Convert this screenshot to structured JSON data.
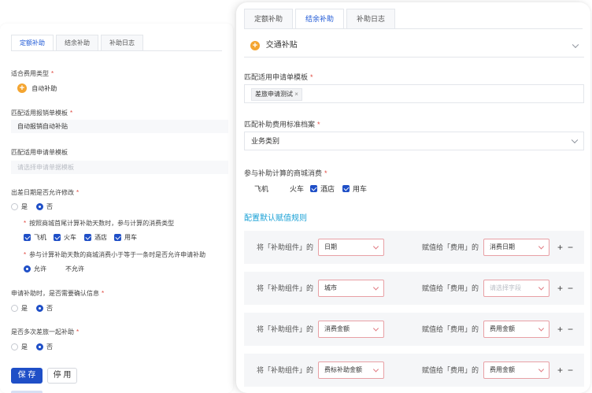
{
  "left": {
    "tabs": [
      "定额补助",
      "结余补助",
      "补助日志"
    ],
    "expense_type": {
      "label": "适合费用类型",
      "value": "自动补助"
    },
    "report_template": {
      "label": "匹配适用报销单模板",
      "value": "自动报销自动补贴"
    },
    "apply_template": {
      "label": "匹配适用申请单模板",
      "placeholder": "请选择申请单据模板"
    },
    "date_modify": {
      "label": "出差日期是否允许修改",
      "options": [
        "是",
        "否"
      ]
    },
    "city_note": "按照商城首尾计算补助天数时，参与计算的消费类型",
    "consume_types": [
      "飞机",
      "火车",
      "酒店",
      "用车"
    ],
    "consume_note": "参与计算补助天数的商城消费小于等于一条时是否允许申请补助",
    "allow_options": [
      "允许",
      "不允许"
    ],
    "confirm_info": {
      "label": "申请补助时，是否需要确认信息",
      "options": [
        "是",
        "否"
      ]
    },
    "multi_trip": {
      "label": "是否多次差旅一起补助",
      "options": [
        "是",
        "否"
      ]
    },
    "save_label": "保 存",
    "stop_label": "停 用"
  },
  "right": {
    "tabs": [
      "定额补助",
      "结余补助",
      "补助日志"
    ],
    "section_title": "交通补贴",
    "apply_template": {
      "label": "匹配适用申请单模板",
      "tag": "差旅申请测试"
    },
    "standard_file": {
      "label": "匹配补助费用标准档案",
      "value": "业务类别"
    },
    "mall_consume": {
      "label": "参与补助计算的商城消费",
      "options": [
        "飞机",
        "火车",
        "酒店",
        "用车"
      ]
    },
    "config_link": "配置默认赋值规则",
    "rule_prefix": "将「补助组件」的",
    "rule_mid": "赋值给「费用」的",
    "rules": [
      {
        "component": "日期",
        "expense": "消费日期",
        "expense_placeholder": false
      },
      {
        "component": "城市",
        "expense": "请选择字段",
        "expense_placeholder": true
      },
      {
        "component": "消费金额",
        "expense": "费用金额",
        "expense_placeholder": false
      },
      {
        "component": "费标补助金额",
        "expense": "费用金额",
        "expense_placeholder": false
      }
    ],
    "plus_minus": [
      "+",
      "−"
    ]
  },
  "colors": {
    "primary": "#1f4fc7",
    "link": "#1aa1d6",
    "required": "#e0483e",
    "icon_orange": "#f4a531"
  }
}
